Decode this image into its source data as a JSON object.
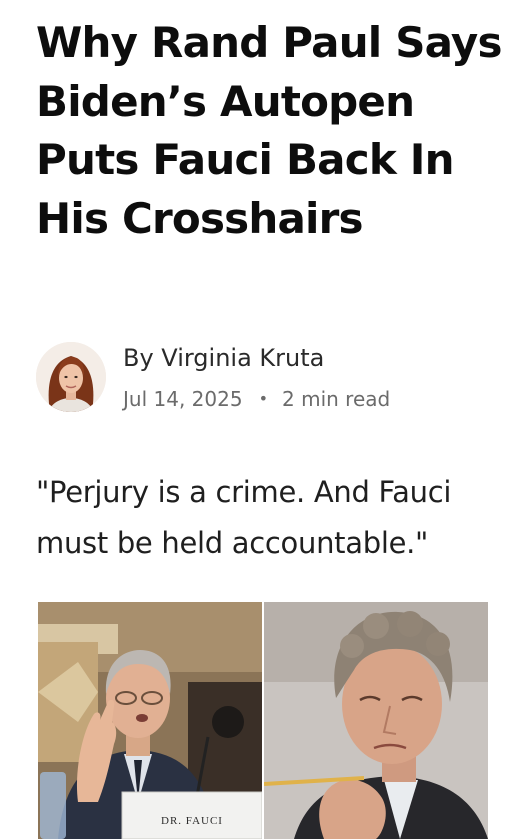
{
  "article": {
    "headline": "Why Rand Paul Says Biden’s Autopen Puts Fauci Back In His Crosshairs",
    "author": "By Virginia Kruta",
    "date": "Jul 14, 2025",
    "separator": "•",
    "read_time": "2 min read",
    "dek": "\"Perjury is a crime. And Fauci must be held accountable.\"",
    "hero": {
      "left_nameplate": "DR. FAUCI"
    }
  },
  "icons": {
    "avatar": "author-avatar-photo"
  }
}
